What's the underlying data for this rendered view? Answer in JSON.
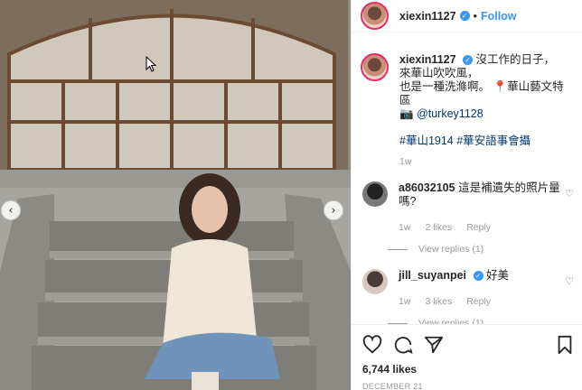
{
  "post": {
    "username": "xiexin1127",
    "follow_label": "Follow",
    "caption_lines": [
      "沒工作的日子，",
      "來華山吹吹風，",
      "也是一種洗滌啊。",
      "華山藝文特區"
    ],
    "caption_mention": "@turkey1128",
    "caption_hashtags": "#華山1914 #華安語事會攝",
    "caption_time": "1w",
    "likes": "6,744 likes",
    "date": "DECEMBER 21"
  },
  "comments": [
    {
      "user": "a86032105",
      "text": "這是補遺失的照片量嗎?",
      "time": "1w",
      "likes": "2 likes",
      "reply": "Reply",
      "view_replies": "View replies (1)"
    },
    {
      "user": "jill_suyanpei",
      "text": "好美",
      "time": "1w",
      "likes": "3 likes",
      "reply": "Reply",
      "view_replies": "View replies (1)"
    }
  ],
  "icons": {
    "prev": "chevron-left-icon",
    "next": "chevron-right-icon",
    "like": "heart-icon",
    "comment": "comment-icon",
    "share": "paper-plane-icon",
    "save": "bookmark-icon"
  },
  "colors": {
    "accent": "#3897f0",
    "story_ring": "#e1306c"
  }
}
